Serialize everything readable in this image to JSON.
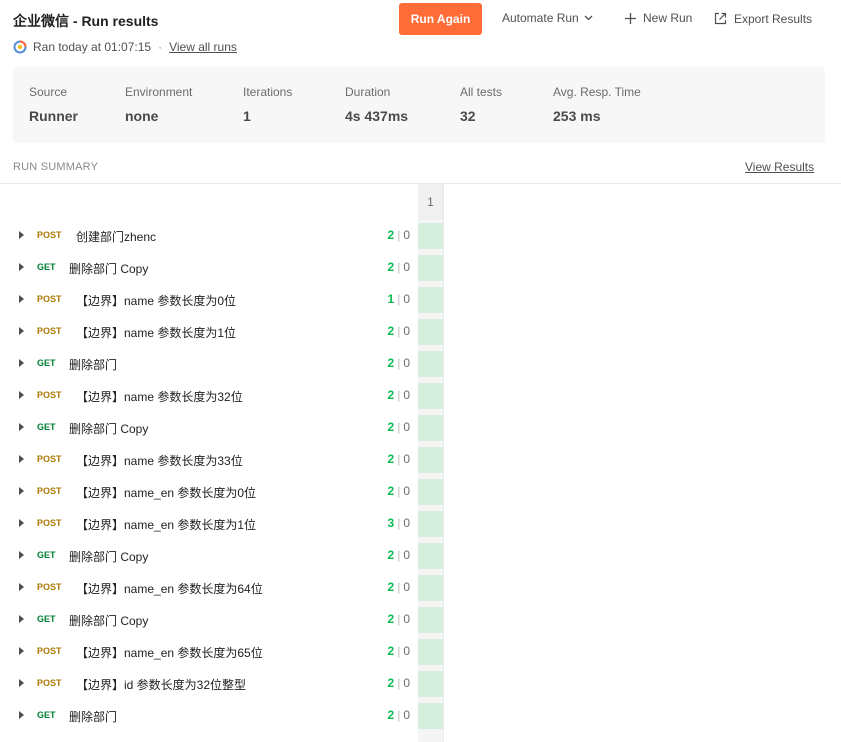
{
  "header": {
    "title": "企业微信 - Run results",
    "ran_text": "Ran today at 01:07:15",
    "separator": "·",
    "view_all_runs": "View all runs",
    "run_again": "Run Again",
    "automate_run": "Automate Run",
    "new_run": "New Run",
    "export_results": "Export Results"
  },
  "stats": [
    {
      "label": "Source",
      "value": "Runner"
    },
    {
      "label": "Environment",
      "value": "none"
    },
    {
      "label": "Iterations",
      "value": "1"
    },
    {
      "label": "Duration",
      "value": "4s 437ms"
    },
    {
      "label": "All tests",
      "value": "32"
    },
    {
      "label": "Avg. Resp. Time",
      "value": "253 ms"
    }
  ],
  "summary": {
    "label": "RUN SUMMARY",
    "view_results": "View Results",
    "iteration_header": "1"
  },
  "requests": [
    {
      "method": "POST",
      "name": "创建部门zhenc",
      "passed": "2",
      "failed": "0"
    },
    {
      "method": "GET",
      "name": "删除部门 Copy",
      "passed": "2",
      "failed": "0"
    },
    {
      "method": "POST",
      "name": "【边界】name 参数长度为0位",
      "passed": "1",
      "failed": "0"
    },
    {
      "method": "POST",
      "name": "【边界】name 参数长度为1位",
      "passed": "2",
      "failed": "0"
    },
    {
      "method": "GET",
      "name": "删除部门",
      "passed": "2",
      "failed": "0"
    },
    {
      "method": "POST",
      "name": "【边界】name 参数长度为32位",
      "passed": "2",
      "failed": "0"
    },
    {
      "method": "GET",
      "name": "删除部门 Copy",
      "passed": "2",
      "failed": "0"
    },
    {
      "method": "POST",
      "name": "【边界】name 参数长度为33位",
      "passed": "2",
      "failed": "0"
    },
    {
      "method": "POST",
      "name": "【边界】name_en 参数长度为0位",
      "passed": "2",
      "failed": "0"
    },
    {
      "method": "POST",
      "name": "【边界】name_en 参数长度为1位",
      "passed": "3",
      "failed": "0"
    },
    {
      "method": "GET",
      "name": "删除部门 Copy",
      "passed": "2",
      "failed": "0"
    },
    {
      "method": "POST",
      "name": "【边界】name_en 参数长度为64位",
      "passed": "2",
      "failed": "0"
    },
    {
      "method": "GET",
      "name": "删除部门 Copy",
      "passed": "2",
      "failed": "0"
    },
    {
      "method": "POST",
      "name": "【边界】name_en 参数长度为65位",
      "passed": "2",
      "failed": "0"
    },
    {
      "method": "POST",
      "name": "【边界】id 参数长度为32位整型",
      "passed": "2",
      "failed": "0"
    },
    {
      "method": "GET",
      "name": "删除部门",
      "passed": "2",
      "failed": "0"
    }
  ],
  "colors": {
    "accent": "#ff6c37",
    "post": "#ad7a03",
    "get": "#007f31",
    "pass": "#0cbb52",
    "cell_pass": "#d6eedd"
  }
}
